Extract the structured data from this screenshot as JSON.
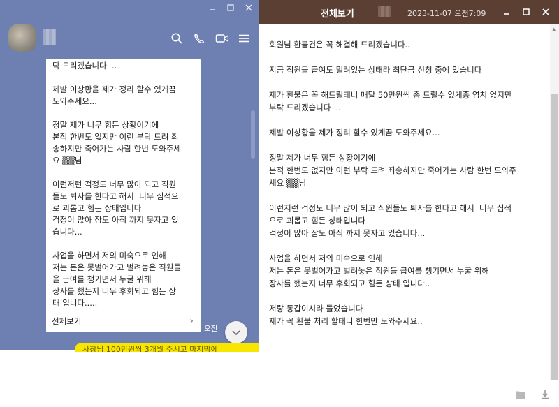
{
  "chat": {
    "bubble_text": "탁 드리겠습니다  ..\n\n제발 이상황을 제가 정리 할수 있게끔\n도와주세요...\n\n정말 제가 너무 힘든 상황이기에\n본적 한번도 없지만 이런 부탁 드려 죄\n송하지만 죽어가는 사람 한번 도와주세\n요 ▒▒님\n\n이런저런 걱정도 너무 많이 되고 직원\n들도 퇴사를 한다고 해서  너무 심적으\n로 괴롭고 힘든 상태입니다\n걱정이 많아 잠도 아직 까지 못자고 있\n습니다...\n\n사업을 하면서 저의 미숙으로 인해\n저는 돈은 못벌어가고 벌려놓은 직원들\n을 급여를 챙기면서 누굴 위해\n장사를 했는지 너무 후회되고 힘든 상\n태 입니다.....",
    "view_all_label": "전체보기",
    "view_all_chevron": "›",
    "time_label": "오전",
    "partial_yellow_text": "사장님 100만원씩 3개월 주시고 마지막에"
  },
  "viewer": {
    "title": "전체보기",
    "date": "2023-11-07 오전7:09",
    "content": "회원님 환불건은 꼭 해결해 드리겠습니다..\n\n지금 직원들 급여도 밀려있는 상태라 최단금 신청 중에 있습니다\n\n제가 환불은 꼭 해드릴테니 매달 50만원씩 좀 드릴수 있게종 염치 없지만\n부탁 드리겠습니다  ..\n\n제발 이상황을 제가 정리 할수 있게끔 도와주세요...\n\n정말 제가 너무 힘든 상황이기에\n본적 한번도 없지만 이런 부탁 드려 죄송하지만 죽어가는 사람 한번 도와주\n세요 ▒▒님\n\n이런저런 걱정도 너무 많이 되고 직원들도 퇴사를 한다고 해서  너무 심적\n으로 괴롭고 힘든 상태입니다\n걱정이 많아 잠도 아직 까지 못자고 있습니다...\n\n사업을 하면서 저의 미숙으로 인해\n저는 돈은 못벌어가고 벌려놓은 직원들 급여를 챙기면서 누굴 위해\n장사를 했는지 너무 후회되고 힘든 상태 입니다..\n\n저랑 동갑이시라 들었습니다\n제가 꼭 환불 처리 할태니 한번만 도와주세요.."
  },
  "icons": {
    "chat_header": [
      "search-icon",
      "phone-icon",
      "video-call-icon",
      "menu-icon"
    ],
    "viewer_footer": [
      "folder-icon",
      "download-icon"
    ]
  },
  "colors": {
    "chat_background": "#6e7fb1",
    "viewer_titlebar": "#5c3f33",
    "yellow_bubble": "#f7e600"
  }
}
